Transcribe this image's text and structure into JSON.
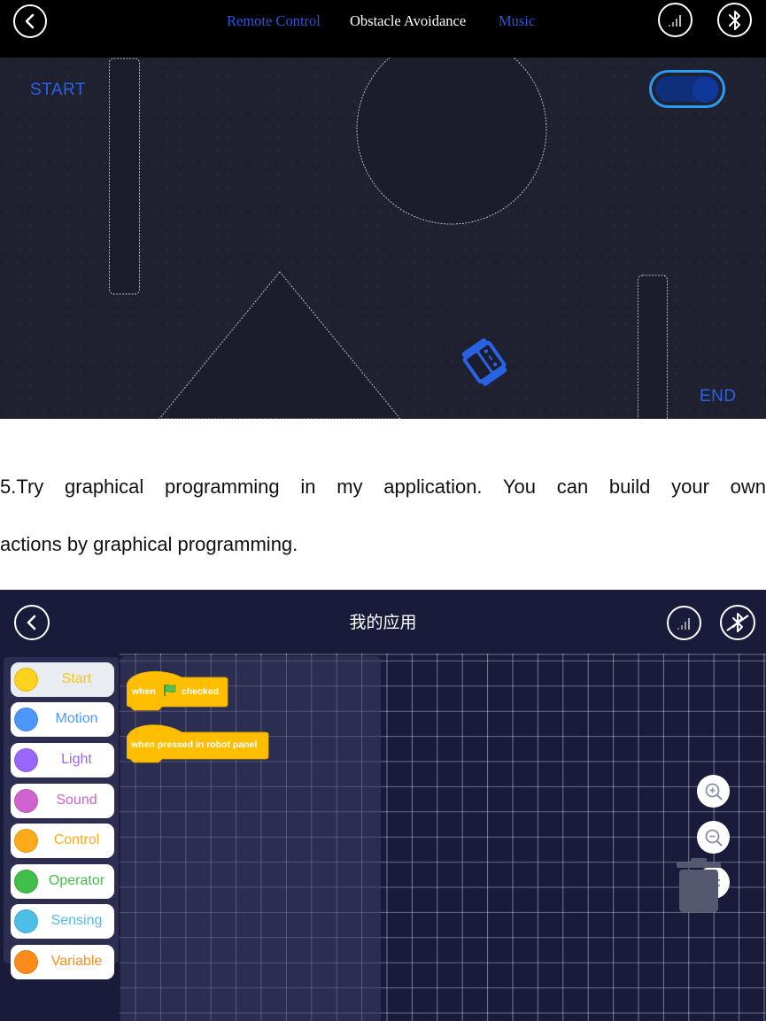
{
  "screenshot1": {
    "nav_tabs": [
      {
        "label": "Remote Control",
        "active": false
      },
      {
        "label": "Obstacle Avoidance",
        "active": true
      },
      {
        "label": "Music",
        "active": false
      }
    ],
    "arena": {
      "start_label": "START",
      "end_label": "END",
      "toggle_on": true
    },
    "icons": {
      "back": "back-chevron-icon",
      "signal": "signal-bars-icon",
      "bluetooth": "bluetooth-icon",
      "robot": "robot-car-icon"
    }
  },
  "instruction": {
    "line1": "5.Try graphical programming in my application. You can build your own",
    "line2": "actions by graphical programming."
  },
  "screenshot2": {
    "title": "我的应用",
    "categories": [
      {
        "label": "Start",
        "color": "#ffd21e",
        "text_color": "#f5c518",
        "selected": true
      },
      {
        "label": "Motion",
        "color": "#4c97ff",
        "text_color": "#4c97ff",
        "selected": false
      },
      {
        "label": "Light",
        "color": "#9966ff",
        "text_color": "#9966ff",
        "selected": false
      },
      {
        "label": "Sound",
        "color": "#cf63cf",
        "text_color": "#cf63cf",
        "selected": false
      },
      {
        "label": "Control",
        "color": "#ffab19",
        "text_color": "#ffab19",
        "selected": false
      },
      {
        "label": "Operator",
        "color": "#40bf4a",
        "text_color": "#40bf4a",
        "selected": false
      },
      {
        "label": "Sensing",
        "color": "#4cbfe6",
        "text_color": "#4cbfe6",
        "selected": false
      },
      {
        "label": "Variable",
        "color": "#ff8c1a",
        "text_color": "#ff8c1a",
        "selected": false
      }
    ],
    "blocks": [
      {
        "prefix": "when",
        "icon": "green-flag-icon",
        "suffix": "checked"
      },
      {
        "text": "when pressed in robot panel"
      }
    ],
    "block_color": "#ffbf00",
    "controls": [
      "zoom-in",
      "zoom-out",
      "reset-zoom"
    ],
    "icons": {
      "back": "back-chevron-icon",
      "signal": "signal-bars-icon",
      "bluetooth": "bluetooth-disconnected-icon",
      "trash": "trash-icon"
    }
  }
}
